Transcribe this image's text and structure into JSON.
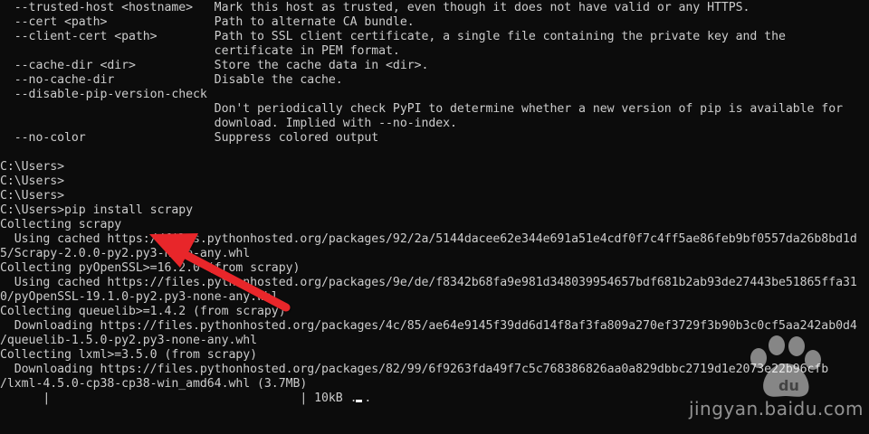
{
  "terminal": {
    "lines": [
      "  --trusted-host <hostname>   Mark this host as trusted, even though it does not have valid or any HTTPS.",
      "  --cert <path>               Path to alternate CA bundle.",
      "  --client-cert <path>        Path to SSL client certificate, a single file containing the private key and the",
      "                              certificate in PEM format.",
      "  --cache-dir <dir>           Store the cache data in <dir>.",
      "  --no-cache-dir              Disable the cache.",
      "  --disable-pip-version-check",
      "                              Don't periodically check PyPI to determine whether a new version of pip is available for",
      "                              download. Implied with --no-index.",
      "  --no-color                  Suppress colored output",
      "",
      "C:\\Users>",
      "C:\\Users>",
      "C:\\Users>",
      "C:\\Users>pip install scrapy",
      "Collecting scrapy",
      "  Using cached https://files.pythonhosted.org/packages/92/2a/5144dacee62e344e691a51e4cdf0f7c4ff5ae86feb9bf0557da26b8bd1d",
      "5/Scrapy-2.0.0-py2.py3-none-any.whl",
      "Collecting pyOpenSSL>=16.2.0 (from scrapy)",
      "  Using cached https://files.pythonhosted.org/packages/9e/de/f8342b68fa9e981d348039954657bdf681b2ab93de27443be51865ffa31",
      "0/pyOpenSSL-19.1.0-py2.py3-none-any.whl",
      "Collecting queuelib>=1.4.2 (from scrapy)",
      "  Downloading https://files.pythonhosted.org/packages/4c/85/ae64e9145f39dd6d14f8af3fa809a270ef3729f3b90b3c0cf5aa242ab0d4",
      "/queuelib-1.5.0-py2.py3-none-any.whl",
      "Collecting lxml>=3.5.0 (from scrapy)",
      "  Downloading https://files.pythonhosted.org/packages/82/99/6f9263fda49f7c5c768386826aa0a829dbbc2719d1e2073e22b96cfb",
      "/lxml-4.5.0-cp38-cp38-win_amd64.whl (3.7MB)",
      "      |                                   | 10kB ..."
    ]
  },
  "colors": {
    "background": "#0c0c0c",
    "text": "#cccccc",
    "arrow": "#e8262a"
  },
  "watermark": {
    "text": "jingyan.baidu.com"
  }
}
